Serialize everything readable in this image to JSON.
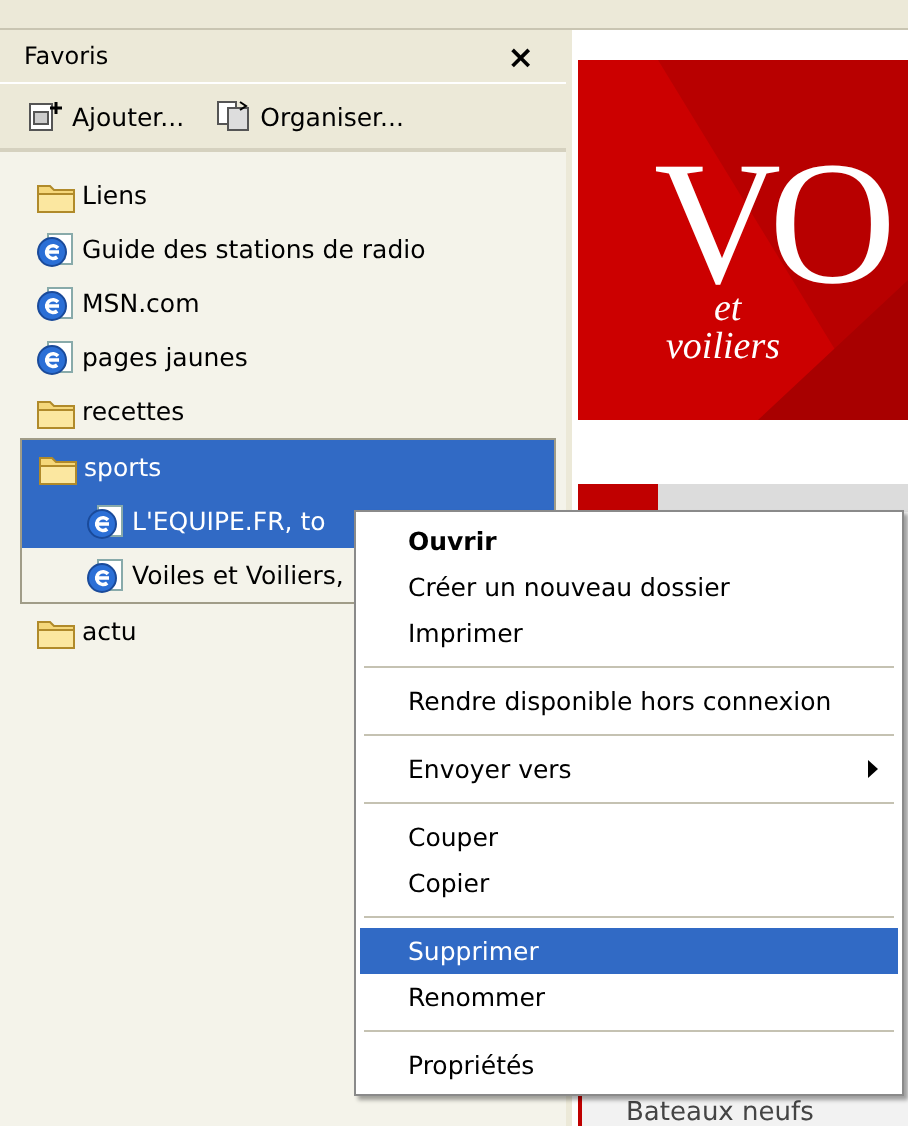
{
  "panel": {
    "title": "Favoris",
    "close": "×"
  },
  "toolbar": [
    {
      "label": "Ajouter...",
      "kind": "add"
    },
    {
      "label": "Organiser...",
      "kind": "organize"
    }
  ],
  "favorites": [
    {
      "label": "Liens",
      "kind": "folder",
      "selected": false
    },
    {
      "label": "Guide des stations de radio",
      "kind": "link",
      "selected": false
    },
    {
      "label": "MSN.com",
      "kind": "link",
      "selected": false
    },
    {
      "label": "pages jaunes",
      "kind": "link",
      "selected": false
    },
    {
      "label": "recettes",
      "kind": "folder",
      "selected": false
    },
    {
      "label": "sports",
      "kind": "folder",
      "selected": true,
      "children": [
        {
          "label": "L'EQUIPE.FR, to",
          "kind": "link",
          "selected": true
        },
        {
          "label": "Voiles et Voiliers,",
          "kind": "link",
          "selected": false
        }
      ]
    },
    {
      "label": "actu",
      "kind": "folder",
      "selected": false
    }
  ],
  "page": {
    "logo": {
      "main": "VO",
      "upper": "et",
      "lower": "voiliers"
    },
    "link": "Bateaux neufs"
  },
  "context_menu": {
    "items": [
      {
        "kind": "item",
        "label": "Ouvrir",
        "bold": true,
        "selected": false,
        "submenu": false
      },
      {
        "kind": "item",
        "label": "Créer un nouveau dossier",
        "bold": false,
        "selected": false,
        "submenu": false
      },
      {
        "kind": "item",
        "label": "Imprimer",
        "bold": false,
        "selected": false,
        "submenu": false
      },
      {
        "kind": "separator"
      },
      {
        "kind": "item",
        "label": "Rendre disponible hors connexion",
        "bold": false,
        "selected": false,
        "submenu": false
      },
      {
        "kind": "separator"
      },
      {
        "kind": "item",
        "label": "Envoyer vers",
        "bold": false,
        "selected": false,
        "submenu": true
      },
      {
        "kind": "separator"
      },
      {
        "kind": "item",
        "label": "Couper",
        "bold": false,
        "selected": false,
        "submenu": false
      },
      {
        "kind": "item",
        "label": "Copier",
        "bold": false,
        "selected": false,
        "submenu": false
      },
      {
        "kind": "separator"
      },
      {
        "kind": "item",
        "label": "Supprimer",
        "bold": false,
        "selected": true,
        "submenu": false
      },
      {
        "kind": "item",
        "label": "Renommer",
        "bold": false,
        "selected": false,
        "submenu": false
      },
      {
        "kind": "separator"
      },
      {
        "kind": "item",
        "label": "Propriétés",
        "bold": false,
        "selected": false,
        "submenu": false
      }
    ]
  }
}
